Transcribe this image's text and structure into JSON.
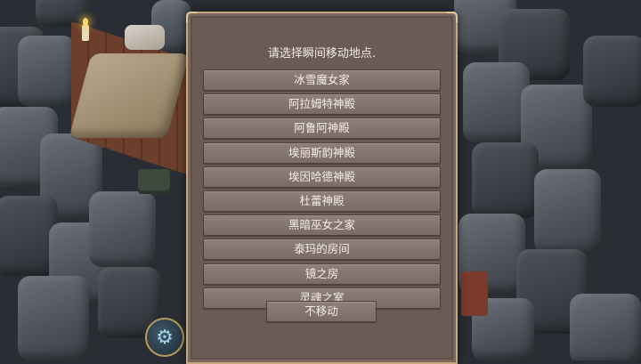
{
  "dialog": {
    "prompt": "请选择瞬间移动地点.",
    "destinations": [
      "冰雪魔女家",
      "阿拉姆特神殿",
      "阿鲁阿神殿",
      "埃丽斯韵神殿",
      "埃因哈德神殿",
      "杜蕾神殿",
      "黑暗巫女之家",
      "泰玛的房间",
      "镜之房",
      "灵魂之室"
    ],
    "cancel_label": "不移动"
  },
  "hud": {
    "settings_icon": "gear-icon"
  },
  "colors": {
    "panel_bg": "#6b5b55",
    "panel_border": "#c8a77a",
    "button_bg": "#8a7b74",
    "text": "#f2ece4"
  }
}
